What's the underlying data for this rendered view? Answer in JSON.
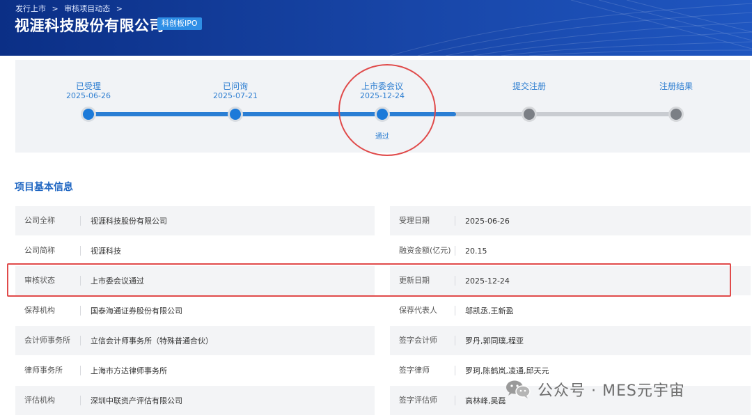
{
  "header": {
    "breadcrumb": [
      "发行上市",
      "审核项目动态"
    ],
    "company_name": "视涯科技股份有限公司",
    "board_badge": "科创板IPO"
  },
  "progress": {
    "steps": [
      {
        "label": "已受理",
        "date": "2025-06-26",
        "state": "done"
      },
      {
        "label": "已问询",
        "date": "2025-07-21",
        "state": "done"
      },
      {
        "label": "上市委会议",
        "date": "2025-12-24",
        "state": "done",
        "result": "通过"
      },
      {
        "label": "提交注册",
        "date": "",
        "state": "pending"
      },
      {
        "label": "注册结果",
        "date": "",
        "state": "pending"
      }
    ]
  },
  "section": {
    "title": "项目基本信息"
  },
  "info": {
    "left": [
      {
        "key": "公司全称",
        "value": "视涯科技股份有限公司"
      },
      {
        "key": "公司简称",
        "value": "视涯科技"
      },
      {
        "key": "审核状态",
        "value": "上市委会议通过"
      },
      {
        "key": "保荐机构",
        "value": "国泰海通证券股份有限公司"
      },
      {
        "key": "会计师事务所",
        "value": "立信会计师事务所（特殊普通合伙）"
      },
      {
        "key": "律师事务所",
        "value": "上海市方达律师事务所"
      },
      {
        "key": "评估机构",
        "value": "深圳中联资产评估有限公司"
      }
    ],
    "right": [
      {
        "key": "受理日期",
        "value": "2025-06-26"
      },
      {
        "key": "融资金额(亿元)",
        "value": "20.15"
      },
      {
        "key": "更新日期",
        "value": "2025-12-24"
      },
      {
        "key": "保荐代表人",
        "value": "邬凯丞,王新盈"
      },
      {
        "key": "签字会计师",
        "value": "罗丹,郭同璞,程亚"
      },
      {
        "key": "签字律师",
        "value": "罗珂,陈鹤岚,凌通,邱天元"
      },
      {
        "key": "签字评估师",
        "value": "高林峰,吴磊"
      }
    ]
  },
  "watermark": {
    "text": "公众号 · MES元宇宙",
    "icon": "wechat-icon"
  },
  "colors": {
    "header_bg": "#1846a8",
    "accent_blue": "#1c7ad9",
    "highlight_red": "#e04a4a",
    "pending_gray": "#7b7f85"
  }
}
